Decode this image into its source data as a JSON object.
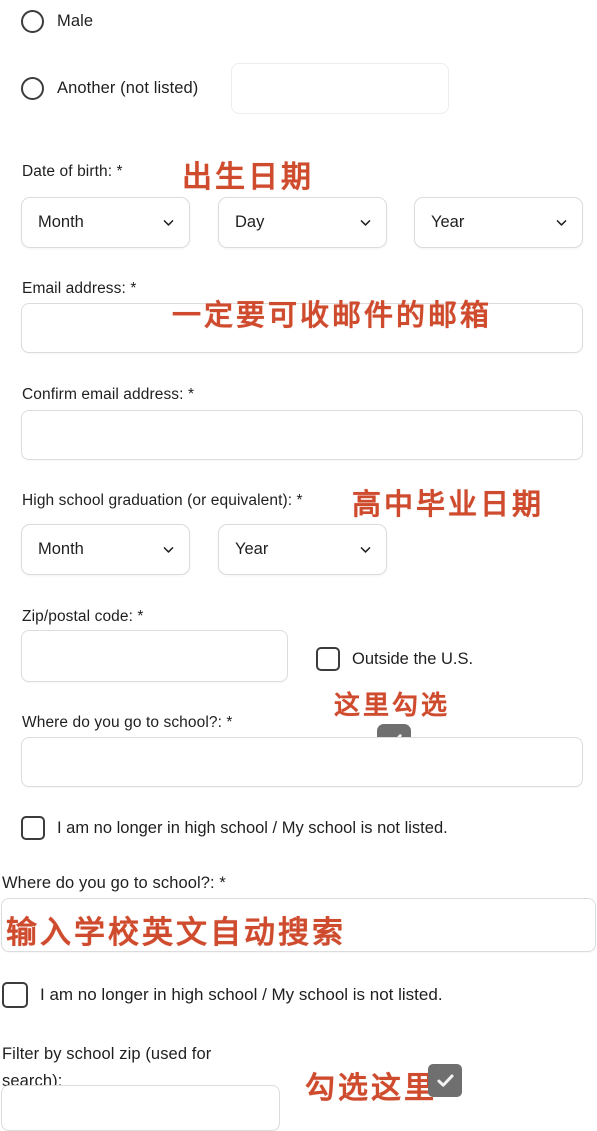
{
  "form": {
    "gender_options": [
      {
        "label": "Male"
      },
      {
        "label": "Another (not listed)"
      }
    ],
    "another_input_value": "",
    "dob": {
      "label": "Date of birth: *",
      "annotation": "出生日期",
      "selects": [
        {
          "value": "Month"
        },
        {
          "value": "Day"
        },
        {
          "value": "Year"
        }
      ]
    },
    "email": {
      "label": "Email address: *",
      "annotation": "一定要可收邮件的邮箱",
      "value": ""
    },
    "confirm_email": {
      "label": "Confirm email address: *",
      "value": ""
    },
    "hs_graduation": {
      "label": "High school graduation (or equivalent): *",
      "annotation": "高中毕业日期",
      "selects": [
        {
          "value": "Month"
        },
        {
          "value": "Year"
        }
      ]
    },
    "zip": {
      "label": "Zip/postal code: *",
      "value": ""
    },
    "outside_us": {
      "label": "Outside the U.S.",
      "annotation": "这里勾选",
      "checked": false
    },
    "school_1": {
      "label": "Where do you go to school?: *",
      "value": ""
    },
    "not_in_school_1": {
      "label": "I am no longer in high school / My school is not listed.",
      "checked": false
    },
    "school_2": {
      "label": "Where do you go to school?: *",
      "annotation": "输入学校英文自动搜索",
      "value": ""
    },
    "not_in_school_2": {
      "label": "I am no longer in high school / My school is not listed.",
      "checked": false
    },
    "school_zip": {
      "label": "Filter by school zip (used for search):",
      "annotation": "勾选这里",
      "value": ""
    }
  },
  "colors": {
    "annotation_red": "#cf4b2e",
    "check_badge_grey": "#6f6f6f",
    "text": "#1f1f1f",
    "border": "#dcdcdc"
  }
}
